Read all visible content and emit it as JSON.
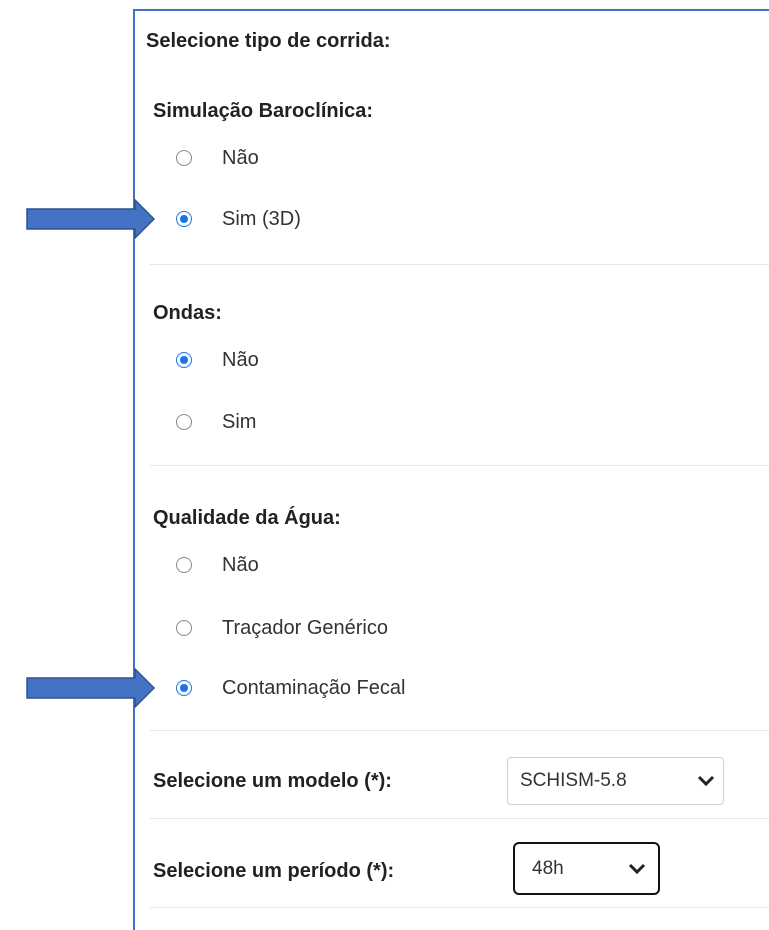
{
  "header": {
    "title": "Selecione tipo de corrida:"
  },
  "baroclinic": {
    "title": "Simulação Baroclínica:",
    "options": [
      {
        "label": "Não",
        "selected": false
      },
      {
        "label": "Sim (3D)",
        "selected": true
      }
    ]
  },
  "waves": {
    "title": "Ondas:",
    "options": [
      {
        "label": "Não",
        "selected": true
      },
      {
        "label": "Sim",
        "selected": false
      }
    ]
  },
  "water_quality": {
    "title": "Qualidade da Água:",
    "options": [
      {
        "label": "Não",
        "selected": false
      },
      {
        "label": "Traçador Genérico",
        "selected": false
      },
      {
        "label": "Contaminação Fecal",
        "selected": true
      }
    ]
  },
  "model": {
    "label": "Selecione um modelo (*):",
    "value": "SCHISM-5.8"
  },
  "period": {
    "label": "Selecione um período (*):",
    "value": "48h"
  },
  "colors": {
    "accent": "#1a73e8",
    "arrow": "#4472c4",
    "panel_border": "#4472c4"
  }
}
